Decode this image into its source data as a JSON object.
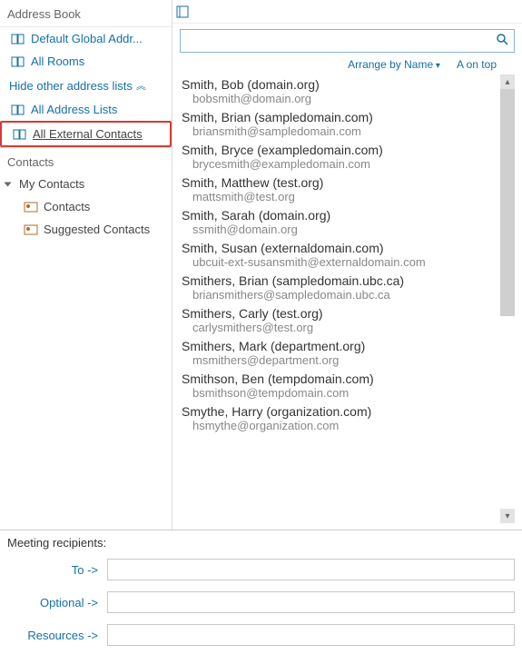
{
  "sidebar": {
    "header": "Address Book",
    "items": [
      {
        "label": "Default Global Addr...",
        "type": "link"
      },
      {
        "label": "All Rooms",
        "type": "link"
      }
    ],
    "hide_link": "Hide other address lists",
    "more_items": [
      {
        "label": "All Address Lists",
        "type": "link"
      },
      {
        "label": "All External Contacts",
        "selected": true
      }
    ],
    "contacts_header": "Contacts",
    "my_contacts": "My Contacts",
    "contacts_sub": [
      {
        "label": "Contacts"
      },
      {
        "label": "Suggested Contacts"
      }
    ]
  },
  "toolbar": {
    "arrange_label": "Arrange by Name",
    "aontop": "A on top"
  },
  "search": {
    "placeholder": ""
  },
  "contacts": [
    {
      "name": "Smith, Bob (domain.org)",
      "email": "bobsmith@domain.org"
    },
    {
      "name": "Smith, Brian (sampledomain.com)",
      "email": "briansmith@sampledomain.com"
    },
    {
      "name": "Smith, Bryce (exampledomain.com)",
      "email": "brycesmith@exampledomain.com"
    },
    {
      "name": "Smith, Matthew (test.org)",
      "email": "mattsmith@test.org"
    },
    {
      "name": "Smith, Sarah (domain.org)",
      "email": "ssmith@domain.org"
    },
    {
      "name": "Smith, Susan (externaldomain.com)",
      "email": "ubcuit-ext-susansmith@externaldomain.com"
    },
    {
      "name": "Smithers, Brian (sampledomain.ubc.ca)",
      "email": "briansmithers@sampledomain.ubc.ca"
    },
    {
      "name": "Smithers, Carly (test.org)",
      "email": "carlysmithers@test.org"
    },
    {
      "name": "Smithers, Mark (department.org)",
      "email": "msmithers@department.org"
    },
    {
      "name": "Smithson, Ben (tempdomain.com)",
      "email": "bsmithson@tempdomain.com"
    },
    {
      "name": "Smythe, Harry (organization.com)",
      "email": "hsmythe@organization.com"
    }
  ],
  "meeting": {
    "title": "Meeting recipients:",
    "to": "To ->",
    "optional": "Optional ->",
    "resources": "Resources ->"
  }
}
